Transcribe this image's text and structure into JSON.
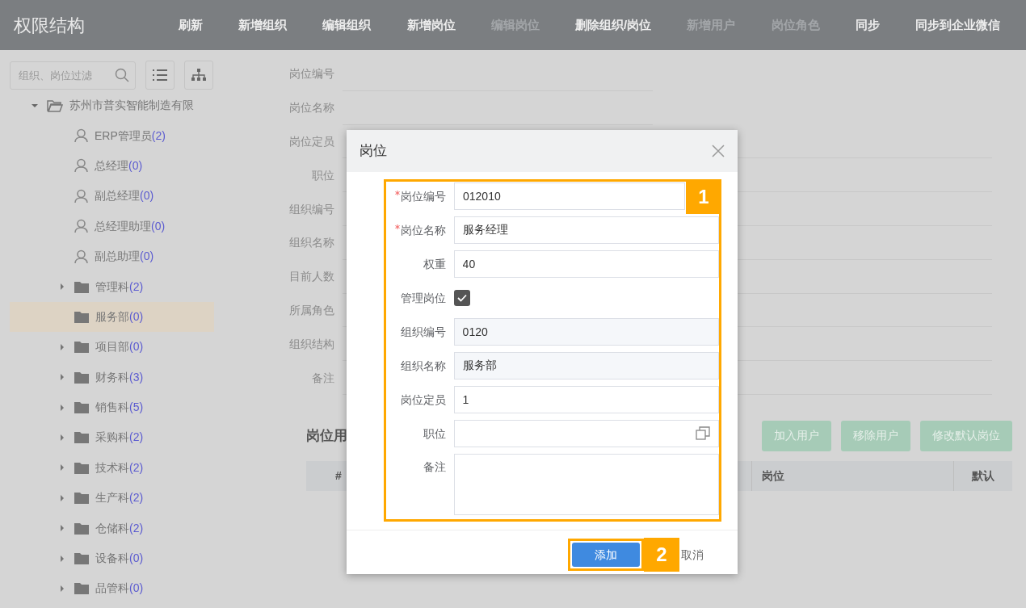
{
  "header": {
    "title": "权限结构",
    "actions": [
      {
        "label": "刷新",
        "disabled": false
      },
      {
        "label": "新增组织",
        "disabled": false
      },
      {
        "label": "编辑组织",
        "disabled": false
      },
      {
        "label": "新增岗位",
        "disabled": false
      },
      {
        "label": "编辑岗位",
        "disabled": true
      },
      {
        "label": "删除组织/岗位",
        "disabled": false
      },
      {
        "label": "新增用户",
        "disabled": true
      },
      {
        "label": "岗位角色",
        "disabled": true
      },
      {
        "label": "同步",
        "disabled": false
      },
      {
        "label": "同步到企业微信",
        "disabled": false
      }
    ]
  },
  "sidebar": {
    "search": {
      "placeholder": "组织、岗位过滤"
    },
    "tree": [
      {
        "kind": "folder",
        "label": "苏州市普实智能制造有限",
        "expandable": true,
        "expanded": true,
        "selected": false,
        "children": [
          {
            "kind": "user",
            "label": "ERP管理员",
            "count": "(2)",
            "expandable": false,
            "expanded": false,
            "selected": false
          },
          {
            "kind": "user",
            "label": "总经理",
            "count": "(0)",
            "expandable": false,
            "expanded": false,
            "selected": false
          },
          {
            "kind": "user",
            "label": "副总经理",
            "count": "(0)",
            "expandable": false,
            "expanded": false,
            "selected": false
          },
          {
            "kind": "user",
            "label": "总经理助理",
            "count": "(0)",
            "expandable": false,
            "expanded": false,
            "selected": false
          },
          {
            "kind": "user",
            "label": "副总助理",
            "count": "(0)",
            "expandable": false,
            "expanded": false,
            "selected": false
          },
          {
            "kind": "folder",
            "label": "管理科",
            "count": "(2)",
            "expandable": true,
            "expanded": false,
            "selected": false
          },
          {
            "kind": "folder",
            "label": "服务部",
            "count": "(0)",
            "expandable": false,
            "expanded": false,
            "selected": true
          },
          {
            "kind": "folder",
            "label": "项目部",
            "count": "(0)",
            "expandable": true,
            "expanded": false,
            "selected": false
          },
          {
            "kind": "folder",
            "label": "财务科",
            "count": "(3)",
            "expandable": true,
            "expanded": false,
            "selected": false
          },
          {
            "kind": "folder",
            "label": "销售科",
            "count": "(5)",
            "expandable": true,
            "expanded": false,
            "selected": false
          },
          {
            "kind": "folder",
            "label": "采购科",
            "count": "(2)",
            "expandable": true,
            "expanded": false,
            "selected": false
          },
          {
            "kind": "folder",
            "label": "技术科",
            "count": "(2)",
            "expandable": true,
            "expanded": false,
            "selected": false
          },
          {
            "kind": "folder",
            "label": "生产科",
            "count": "(2)",
            "expandable": true,
            "expanded": false,
            "selected": false
          },
          {
            "kind": "folder",
            "label": "仓储科",
            "count": "(2)",
            "expandable": true,
            "expanded": false,
            "selected": false
          },
          {
            "kind": "folder",
            "label": "设备科",
            "count": "(0)",
            "expandable": true,
            "expanded": false,
            "selected": false
          },
          {
            "kind": "folder",
            "label": "品管科",
            "count": "(0)",
            "expandable": true,
            "expanded": false,
            "selected": false
          }
        ]
      }
    ]
  },
  "detail": {
    "fields": [
      {
        "label": "岗位编号"
      },
      {
        "label": "岗位名称"
      },
      {
        "label": "岗位定员"
      },
      {
        "label": "职位"
      },
      {
        "label": "组织编号"
      },
      {
        "label": "组织名称"
      },
      {
        "label": "目前人数"
      },
      {
        "label": "所属角色"
      },
      {
        "label": "组织结构"
      },
      {
        "label": "备注"
      }
    ],
    "users_title": "岗位用",
    "buttons": [
      "加入用户",
      "移除用户",
      "修改默认岗位"
    ],
    "table": {
      "columns": [
        "#",
        "岗位",
        "默认"
      ]
    }
  },
  "dialog": {
    "title": "岗位",
    "fields": [
      {
        "kind": "text",
        "label": "岗位编号",
        "required": true,
        "value": "012010"
      },
      {
        "kind": "text",
        "label": "岗位名称",
        "required": true,
        "value": "服务经理"
      },
      {
        "kind": "text",
        "label": "权重",
        "required": false,
        "value": "40"
      },
      {
        "kind": "checkbox",
        "label": "管理岗位",
        "required": false,
        "checked": true
      },
      {
        "kind": "readonly",
        "label": "组织编号",
        "required": false,
        "value": "0120"
      },
      {
        "kind": "readonly",
        "label": "组织名称",
        "required": false,
        "value": "服务部"
      },
      {
        "kind": "text",
        "label": "岗位定员",
        "required": false,
        "value": "1"
      },
      {
        "kind": "picker",
        "label": "职位",
        "required": false
      },
      {
        "kind": "textarea",
        "label": "备注",
        "required": false
      }
    ],
    "form_callout": "1",
    "submit": "添加",
    "submit_callout": "2",
    "cancel": "取消"
  }
}
